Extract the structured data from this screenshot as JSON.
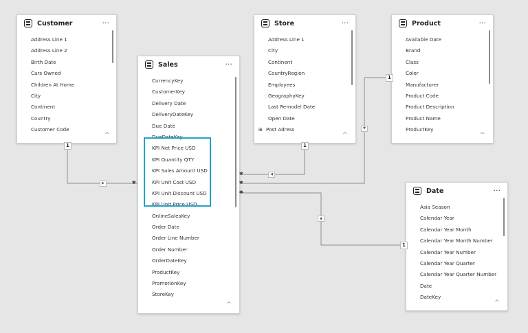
{
  "tables": {
    "customer": {
      "title": "Customer",
      "fields": [
        "Address Line 1",
        "Address Line 2",
        "Birth Date",
        "Cars Owned",
        "Children At Home",
        "City",
        "Continent",
        "Country",
        "Customer Code"
      ]
    },
    "sales": {
      "title": "Sales",
      "fields": [
        "CurrencyKey",
        "CustomerKey",
        "Delivery Date",
        "DeliveryDateKey",
        "Due Date",
        "DueDateKey",
        "KPI Net Price USD",
        "KPI Quantity QTY",
        "KPI Sales Amount USD",
        "KPI Unit Cost USD",
        "KPI Unit Discount USD",
        "KPI Unit Price USD",
        "OnlineSalesKey",
        "Order Date",
        "Order Line Number",
        "Order Number",
        "OrderDateKey",
        "ProductKey",
        "PromotionKey",
        "StoreKey"
      ]
    },
    "store": {
      "title": "Store",
      "fields": [
        "Address Line 1",
        "City",
        "Continent",
        "CountryRegion",
        "Employees",
        "GeographyKey",
        "Last Remodel Date",
        "Open Date",
        "Post Adress"
      ]
    },
    "product": {
      "title": "Product",
      "fields": [
        "Available Date",
        "Brand",
        "Class",
        "Color",
        "Manufacturer",
        "Product Code",
        "Product Description",
        "Product Name",
        "ProductKey"
      ]
    },
    "date": {
      "title": "Date",
      "fields": [
        "Asia Season",
        "Calendar Year",
        "Calendar Year Month",
        "Calendar Year Month Number",
        "Calendar Year Number",
        "Calendar Year Quarter",
        "Calendar Year Quarter Number",
        "Date",
        "DateKey"
      ]
    }
  },
  "relationships": {
    "one": "1",
    "many": "*"
  },
  "icons": {
    "table": "table-icon",
    "more": "more-options-icon",
    "caret": "chevron-up-icon",
    "hierarchy": "hierarchy-icon"
  },
  "colors": {
    "highlight": "#1ea3c9",
    "caret": "#36a4c8"
  },
  "ui": {
    "more_label": "···",
    "caret_label": "^"
  }
}
